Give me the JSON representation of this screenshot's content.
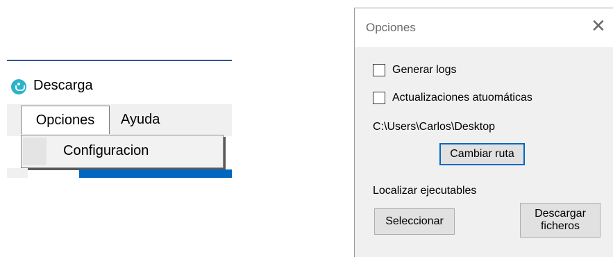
{
  "app": {
    "title": "Descarga",
    "menu": {
      "opciones": "Opciones",
      "ayuda": "Ayuda",
      "dropdown_items": [
        "Configuracion"
      ]
    }
  },
  "dialog": {
    "title": "Opciones",
    "close_glyph": "✕",
    "checkboxes": [
      {
        "label": "Generar logs",
        "checked": false
      },
      {
        "label": "Actualizaciones atuomáticas",
        "checked": false
      }
    ],
    "path": "C:\\Users\\Carlos\\Desktop",
    "change_path_button": "Cambiar ruta",
    "locate_label": "Localizar ejecutables",
    "select_button": "Seleccionar",
    "download_button_line1": "Descargar",
    "download_button_line2": "ficheros"
  },
  "colors": {
    "accent": "#0067c0",
    "app_icon": "#2bb3c8",
    "dialog_bg": "#f0f0f0",
    "button_bg": "#e1e1e1"
  }
}
